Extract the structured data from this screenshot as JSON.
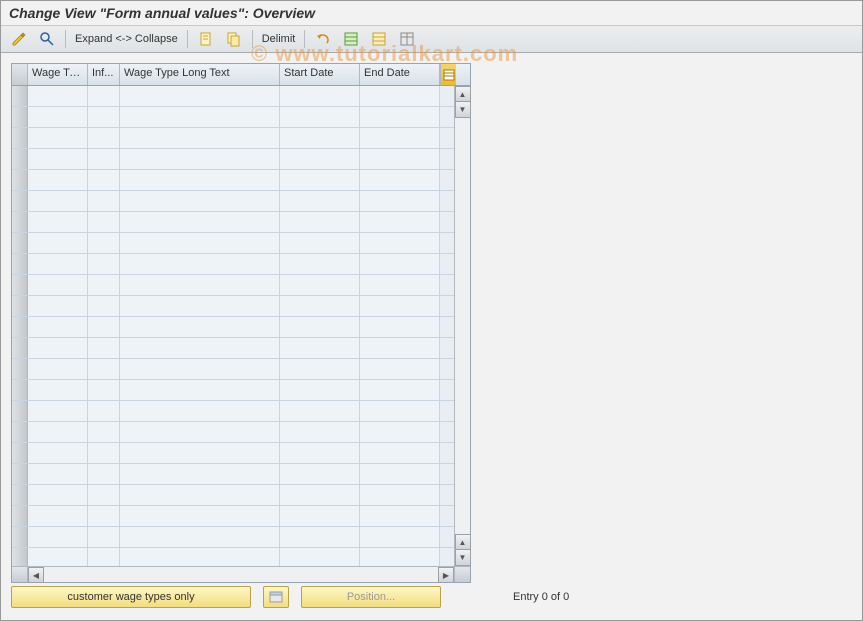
{
  "title": "Change View \"Form annual values\": Overview",
  "toolbar": {
    "expand_collapse": "Expand <-> Collapse",
    "delimit": "Delimit"
  },
  "columns": {
    "wage_type": "Wage Ty...",
    "inf": "Inf...",
    "long_text": "Wage Type Long Text",
    "start_date": "Start Date",
    "end_date": "End Date"
  },
  "rows": [
    {},
    {},
    {},
    {},
    {},
    {},
    {},
    {},
    {},
    {},
    {},
    {},
    {},
    {},
    {},
    {},
    {},
    {},
    {},
    {},
    {},
    {},
    {}
  ],
  "footer": {
    "customer_btn": "customer wage types only",
    "position_btn": "Position...",
    "entry_text": "Entry 0 of 0"
  },
  "watermark": "© www.tutorialkart.com"
}
